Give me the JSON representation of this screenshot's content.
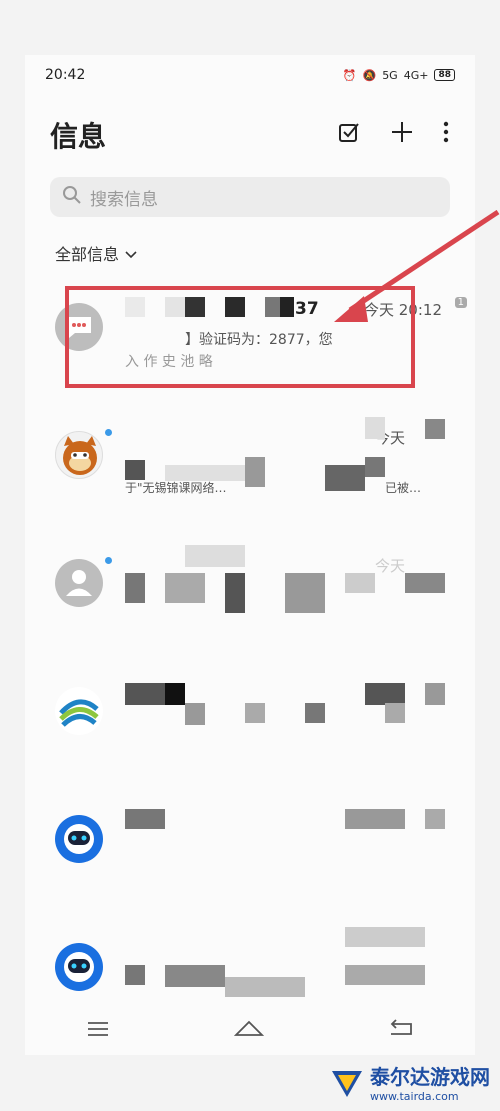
{
  "status_bar": {
    "time": "20:42",
    "signal_1": "5G",
    "signal_2": "4G+",
    "battery": "88"
  },
  "header": {
    "title": "信息"
  },
  "search": {
    "placeholder": "搜索信息"
  },
  "filter": {
    "label": "全部信息"
  },
  "messages": [
    {
      "title": "37",
      "time": "今天 20:12",
      "badge": "1",
      "preview_line1": "】验证码为：2877，您",
      "preview_line2": "入 作 史 池 略"
    },
    {
      "time": "今天",
      "preview_line1": "于\"无锡锦课网络…",
      "preview_line2": "已被…"
    },
    {
      "time": "今天"
    },
    {
      "time": ""
    },
    {
      "time": ""
    },
    {
      "time": ""
    }
  ],
  "watermark": {
    "brand": "泰尔达游戏网",
    "url": "www.tairda.com"
  },
  "colors": {
    "highlight": "#d9454d",
    "unread_dot": "#3b9ae8",
    "brand": "#1f4fa3"
  }
}
